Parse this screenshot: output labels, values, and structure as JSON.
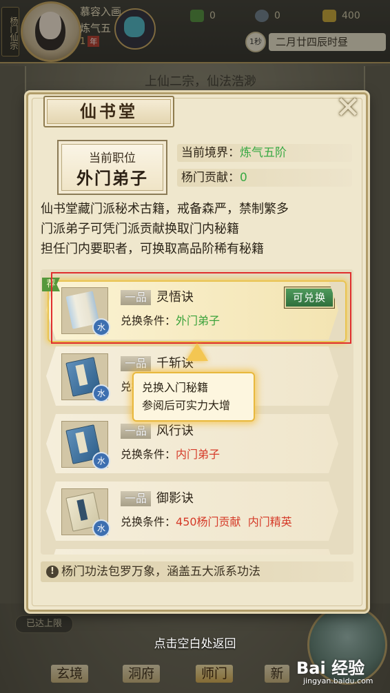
{
  "topbar": {
    "sect_tag": "杨门仙宗",
    "player_name": "慕容入画",
    "realm_short": "炼气五",
    "years": "1",
    "years_unit": "年",
    "resources": [
      {
        "name": "spirit-herb",
        "value": "0",
        "color": "#4f8d3b"
      },
      {
        "name": "coin",
        "value": "0",
        "color": "#6c7c8c"
      },
      {
        "name": "gold",
        "value": "400",
        "color": "#c9a534"
      }
    ],
    "tick": "1秒",
    "date_time": "二月廿四辰时昼"
  },
  "background": {
    "banner": "上仙二宗，仙法浩渺"
  },
  "dialog": {
    "title": "仙书堂",
    "position_label": "当前职位",
    "position_value": "外门弟子",
    "realm_label": "当前境界：",
    "realm_value": "炼气五阶",
    "contribution_label": "杨门贡献：",
    "contribution_value": "0",
    "description": [
      "仙书堂藏门派秘术古籍，戒备森严，禁制繁多",
      "门派弟子可凭门派贡献换取门内秘籍",
      "担任门内要职者，可换取高品阶稀有秘籍"
    ],
    "recommend_tag": "荐",
    "exchange_btn": "可兑换",
    "cond_label": "兑换条件：",
    "books": [
      {
        "grade": "一品",
        "name": "灵悟诀",
        "element": "水",
        "conditions": [
          "外门弟子"
        ],
        "cond_color": "green",
        "cover": "scroll",
        "selected": true
      },
      {
        "grade": "一品",
        "name": "千斩诀",
        "element": "水",
        "conditions": [],
        "cond_color": "red",
        "cover": "blue",
        "selected": false
      },
      {
        "grade": "一品",
        "name": "风行诀",
        "element": "水",
        "conditions": [
          "内门弟子"
        ],
        "cond_color": "red",
        "cover": "blue",
        "selected": false
      },
      {
        "grade": "一品",
        "name": "御影诀",
        "element": "水",
        "conditions": [
          "450杨门贡献",
          "内门精英"
        ],
        "cond_color": "red",
        "cover": "cream",
        "selected": false
      }
    ],
    "tooltip": [
      "兑换入门秘籍",
      "参阅后可实力大增"
    ],
    "notice": "杨门功法包罗万象，涵盖五大派系功法"
  },
  "bottom": {
    "reached_limit": "已达上限",
    "hint": "点击空白处返回",
    "nav": [
      "玄境",
      "洞府",
      "师门",
      "新"
    ],
    "active_nav": "师门"
  },
  "watermark": {
    "main": "Bai 经验",
    "sub": "jingyan.baidu.com"
  }
}
